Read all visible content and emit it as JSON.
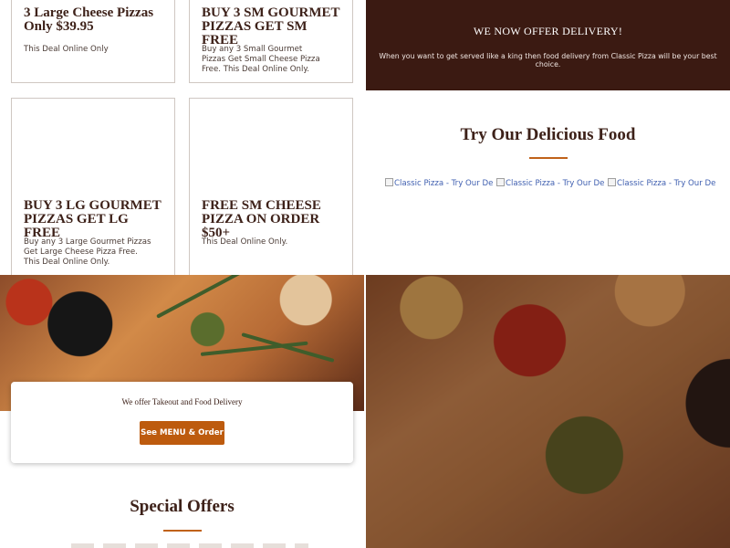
{
  "deals": [
    {
      "title": "3 Large Cheese Pizzas Only $39.95",
      "description": "This Deal Online Only"
    },
    {
      "title": "BUY 3 SM GOURMET PIZZAS GET SM FREE",
      "description": "Buy any 3 Small Gourmet Pizzas Get Small Cheese Pizza Free. This Deal Online Only."
    },
    {
      "title": "BUY 3 LG GOURMET PIZZAS GET LG FREE",
      "description": "Buy any 3 Large Gourmet Pizzas Get Large Cheese Pizza Free. This Deal Online Only."
    },
    {
      "title": "FREE SM CHEESE PIZZA ON ORDER $50+",
      "description": "This Deal Online Only."
    }
  ],
  "delivery": {
    "heading": "WE NOW OFFER DELIVERY!",
    "text": "When you want to get served like a king then food delivery from Classic Pizza will be your best choice."
  },
  "food": {
    "heading": "Try Our Delicious Food",
    "image_alts": [
      "Classic Pizza - Try Our Delic",
      "Classic Pizza - Try Our Delic",
      "Classic Pizza - Try Our Delic"
    ]
  },
  "takeout": {
    "text": "We offer Takeout and Food Delivery",
    "button": "See MENU & Order"
  },
  "special_offers": {
    "heading": "Special Offers"
  },
  "colors": {
    "brown": "#3b1a12",
    "accent": "#c0621a",
    "button": "#bd5b0e"
  }
}
